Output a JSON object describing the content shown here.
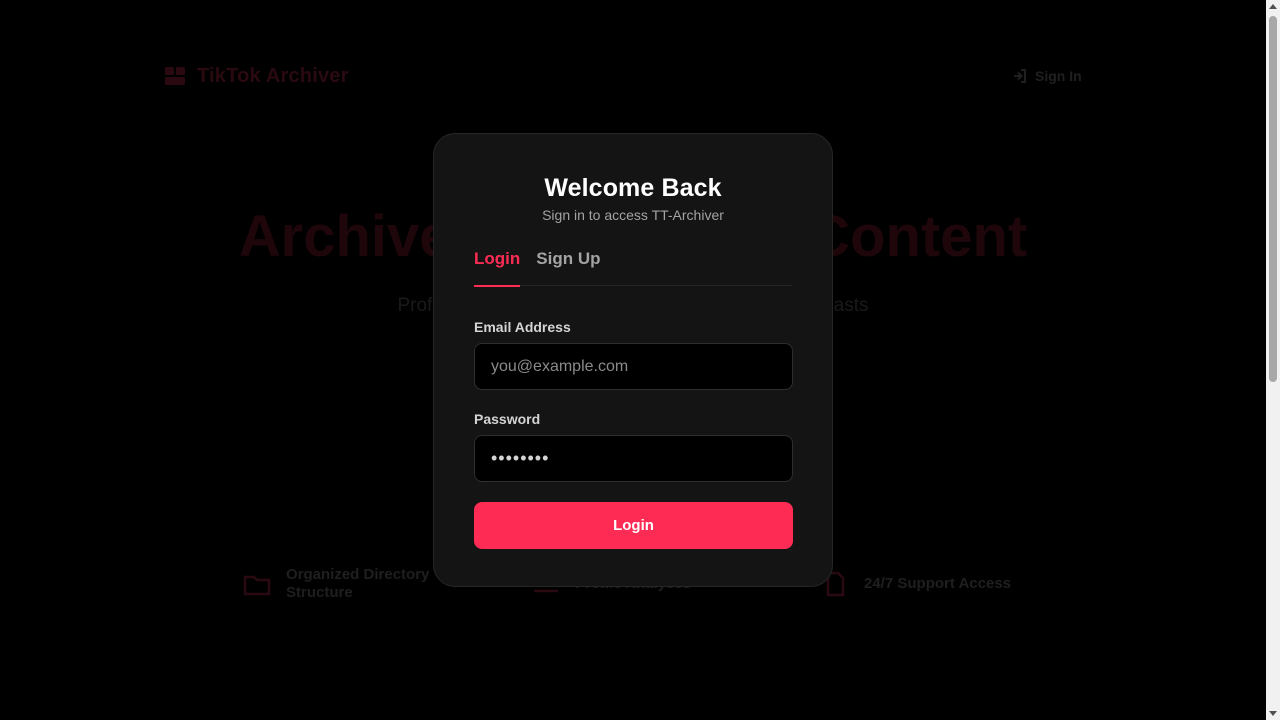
{
  "background": {
    "brand": "TikTok Archiver",
    "nav_signin": "Sign In",
    "hero_title": "Archive Your TikTok Content",
    "hero_subtitle": "Professional archiving tools for creators and enthusiasts",
    "features": [
      {
        "line1": "Organized Directory",
        "line2": "Structure",
        "icon": "folder-icon"
      },
      {
        "line1": "Profile Analyses",
        "line2": "",
        "icon": "chart-icon"
      },
      {
        "line1": "24/7 Support Access",
        "line2": "",
        "icon": "support-icon"
      }
    ]
  },
  "modal": {
    "title": "Welcome Back",
    "subtitle": "Sign in to access TT-Archiver",
    "tabs": [
      {
        "label": "Login",
        "active": true
      },
      {
        "label": "Sign Up",
        "active": false
      }
    ],
    "email": {
      "label": "Email Address",
      "placeholder": "you@example.com",
      "value": ""
    },
    "password": {
      "label": "Password",
      "value": "12345678"
    },
    "submit_label": "Login"
  },
  "colors": {
    "accent": "#fe2c55",
    "modal_bg": "#141414",
    "page_bg": "#000000",
    "muted_text": "#a3a3a3"
  }
}
